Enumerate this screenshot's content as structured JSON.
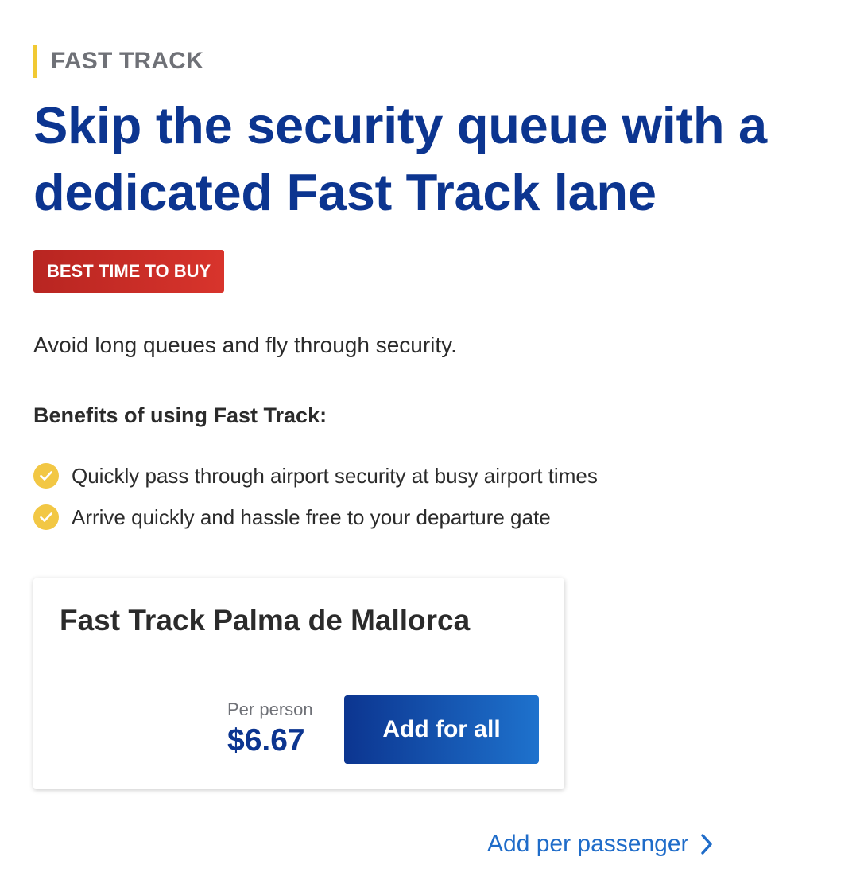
{
  "section": {
    "eyebrow": "FAST TRACK",
    "headline": "Skip the security queue with a dedicated Fast Track lane",
    "badge": "BEST TIME TO BUY",
    "intro": "Avoid long queues and fly through security.",
    "benefits_heading": "Benefits of using Fast Track:",
    "benefits": [
      "Quickly pass through airport security at busy airport times",
      "Arrive quickly and hassle free to your departure gate"
    ]
  },
  "product_card": {
    "title": "Fast Track Palma de Mallorca",
    "price_label": "Per person",
    "price": "$6.67",
    "add_all_label": "Add for all"
  },
  "links": {
    "add_per_passenger": "Add per passenger"
  },
  "icons": {
    "benefit": "check-circle-icon",
    "link": "chevron-right-icon"
  },
  "colors": {
    "brand_blue": "#0c3590",
    "accent_yellow": "#f1c933",
    "badge_red": "#c62d26",
    "link_blue": "#1f6cc9"
  }
}
